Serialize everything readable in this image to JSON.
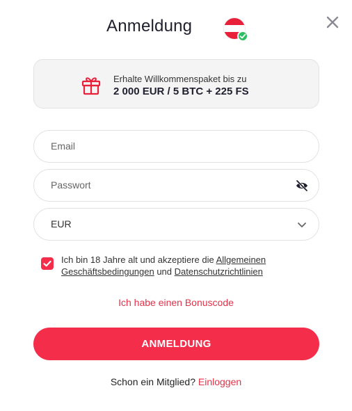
{
  "header": {
    "title": "Anmeldung",
    "flag_icon": "austria-flag-icon",
    "close_icon": "close-icon"
  },
  "promo": {
    "icon": "gift-icon",
    "line1": "Erhalte Willkommenspaket bis zu",
    "line2": "2 000 EUR / 5 BTC + 225 FS"
  },
  "form": {
    "email_placeholder": "Email",
    "password_placeholder": "Passwort",
    "password_toggle_icon": "eye-off-icon",
    "currency_value": "EUR",
    "currency_icon": "chevron-down-icon"
  },
  "terms": {
    "checked": true,
    "prefix": "Ich bin 18 Jahre alt und akzeptiere die ",
    "link1": "Allgemeinen Geschäftsbedingungen",
    "middle": " und ",
    "link2": "Datenschutzrichtlinien"
  },
  "bonus_link": "Ich habe einen Bonuscode",
  "submit_label": "ANMELDUNG",
  "footer": {
    "question": "Schon ein Mitglied? ",
    "login_link": "Einloggen"
  },
  "colors": {
    "accent": "#f42e4a",
    "link_red": "#e2334a",
    "check_green": "#2dbe5f"
  }
}
